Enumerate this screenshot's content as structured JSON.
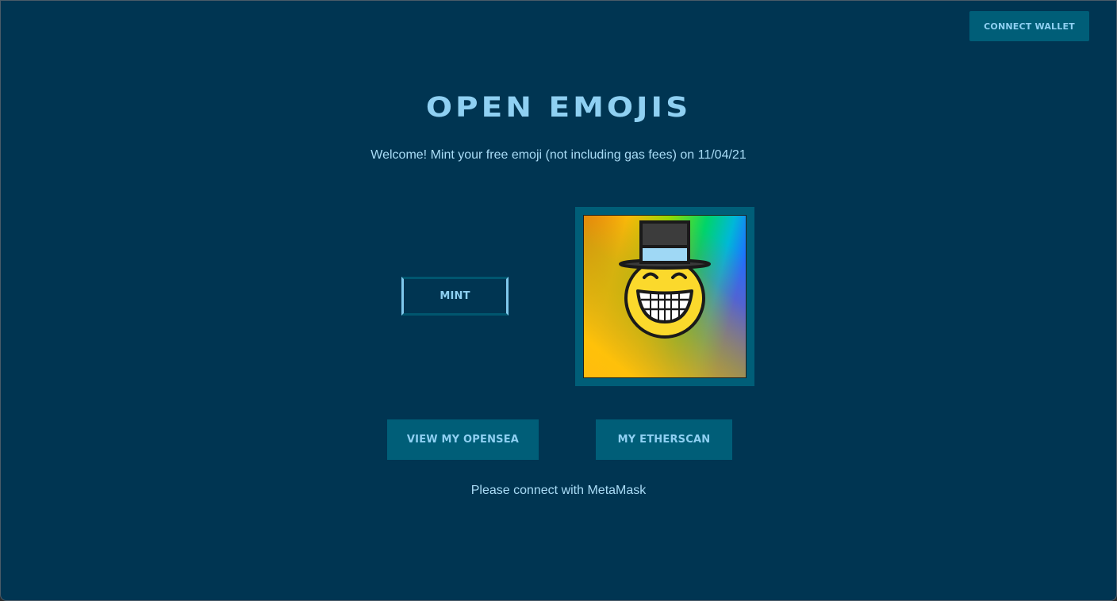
{
  "header": {
    "connect_wallet_label": "CONNECT WALLET"
  },
  "main": {
    "title": "OPEN EMOJIS",
    "welcome_text": "Welcome! Mint your free emoji (not including gas fees) on 11/04/21",
    "mint_label": "MINT",
    "emoji": {
      "icon": "grinning-face-with-top-hat-icon",
      "background": "rainbow-gradient"
    },
    "links": {
      "opensea_label": "VIEW MY OPENSEA",
      "etherscan_label": "MY ETHERSCAN"
    },
    "status_text": "Please connect with MetaMask"
  },
  "colors": {
    "background": "#003552",
    "button": "#005e78",
    "text_accent": "#8fd0f2"
  }
}
